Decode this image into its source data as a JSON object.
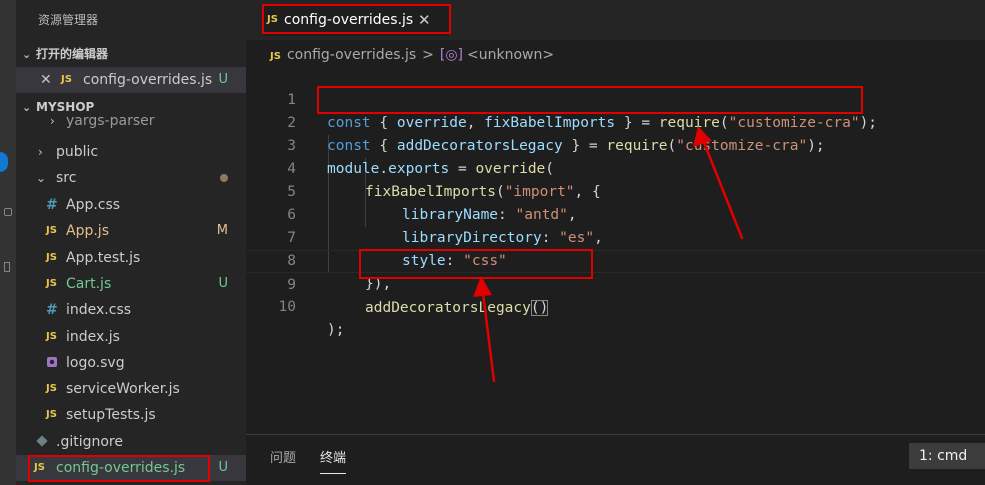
{
  "explorer": {
    "title": "资源管理器",
    "open_editors": {
      "label": "打开的编辑器",
      "items": [
        {
          "name": "config-overrides.js",
          "icon": "js-file-icon",
          "badge": "U"
        }
      ]
    },
    "workspace": {
      "label": "MYSHOP",
      "items": [
        {
          "name": "yargs-parser",
          "type": "folder",
          "badge": ""
        },
        {
          "name": "public",
          "type": "folder",
          "badge": ""
        },
        {
          "name": "src",
          "type": "folder",
          "badge": ""
        },
        {
          "name": "App.css",
          "type": "css",
          "badge": ""
        },
        {
          "name": "App.js",
          "type": "js",
          "badge": "M"
        },
        {
          "name": "App.test.js",
          "type": "js",
          "badge": ""
        },
        {
          "name": "Cart.js",
          "type": "js",
          "badge": "U"
        },
        {
          "name": "index.css",
          "type": "css",
          "badge": ""
        },
        {
          "name": "index.js",
          "type": "js",
          "badge": ""
        },
        {
          "name": "logo.svg",
          "type": "svg",
          "badge": ""
        },
        {
          "name": "serviceWorker.js",
          "type": "js",
          "badge": ""
        },
        {
          "name": "setupTests.js",
          "type": "js",
          "badge": ""
        },
        {
          "name": ".gitignore",
          "type": "git",
          "badge": ""
        },
        {
          "name": "config-overrides.js",
          "type": "js",
          "badge": "U"
        }
      ]
    }
  },
  "icons": {
    "js": "JS",
    "css": "#",
    "close": "✕",
    "chevron_down": "⌄",
    "chevron_right": "›",
    "symbol": "[◎]"
  },
  "editor": {
    "tab": {
      "label": "config-overrides.js",
      "icon": "JS"
    },
    "breadcrumb": {
      "file": "config-overrides.js",
      "separator": ">",
      "symbol": "<unknown>"
    },
    "line_numbers": [
      "1",
      "2",
      "3",
      "4",
      "5",
      "6",
      "7",
      "8",
      "9",
      "10"
    ],
    "code": {
      "l1": {
        "kw": "const",
        "open": " { ",
        "a": "override",
        "comma": ", ",
        "b": "fixBabelImports",
        "close": " } = ",
        "fn": "require",
        "p1": "(",
        "str": "\"customize-cra\"",
        "p2": ");"
      },
      "l2": {
        "kw": "const",
        "open": " { ",
        "a": "addDecoratorsLegacy",
        "close": " } = ",
        "fn": "require",
        "p1": "(",
        "str": "\"customize-cra\"",
        "p2": ");"
      },
      "l3": {
        "a": "module",
        "dot": ".",
        "b": "exports",
        "eq": " = ",
        "fn": "override",
        "p": "("
      },
      "l4": {
        "fn": "fixBabelImports",
        "p1": "(",
        "str": "\"import\"",
        "p2": ", {"
      },
      "l5": {
        "prop": "libraryName",
        "colon": ": ",
        "str": "\"antd\"",
        "comma": ","
      },
      "l6": {
        "prop": "libraryDirectory",
        "colon": ": ",
        "str": "\"es\"",
        "comma": ","
      },
      "l7": {
        "prop": "style",
        "colon": ": ",
        "str": "\"css\""
      },
      "l8": {
        "txt": "}),"
      },
      "l9": {
        "fn": "addDecoratorsLegacy",
        "p": "()"
      },
      "l10": {
        "txt": ");"
      }
    }
  },
  "panel": {
    "tabs": [
      "问题",
      "终端"
    ],
    "terminal_select": "1: cmd"
  },
  "colors": {
    "annotation": "#e00000",
    "js_icon": "#e8c84b",
    "untracked": "#73c991",
    "modified": "#e2c08d"
  }
}
